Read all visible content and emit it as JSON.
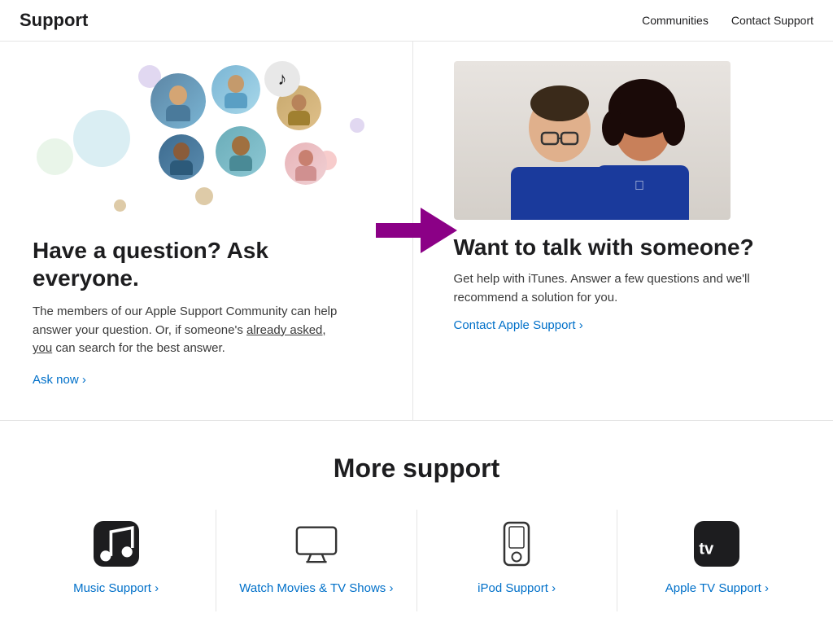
{
  "header": {
    "logo": "Support",
    "nav": [
      {
        "label": "Communities",
        "id": "communities"
      },
      {
        "label": "Contact Support",
        "id": "contact-support"
      }
    ]
  },
  "left_panel": {
    "heading": "Have a question? Ask everyone.",
    "body": "The members of our Apple Support Community can help answer your question. Or, if someone's already asked, you can search for the best answer.",
    "underline_text": "already asked, you",
    "cta_label": "Ask now ›"
  },
  "right_panel": {
    "heading": "Want to talk with someone?",
    "body": "Get help with iTunes. Answer a few questions and we'll recommend a solution for you.",
    "cta_label": "Contact Apple Support ›"
  },
  "more_support": {
    "heading": "More support",
    "items": [
      {
        "id": "music",
        "label": "Music Support ›",
        "icon_type": "music"
      },
      {
        "id": "watch",
        "label": "Watch Movies & TV Shows ›",
        "icon_type": "tv"
      },
      {
        "id": "ipod",
        "label": "iPod Support ›",
        "icon_type": "ipod"
      },
      {
        "id": "appletv",
        "label": "Apple TV Support ›",
        "icon_type": "appletv"
      }
    ]
  }
}
